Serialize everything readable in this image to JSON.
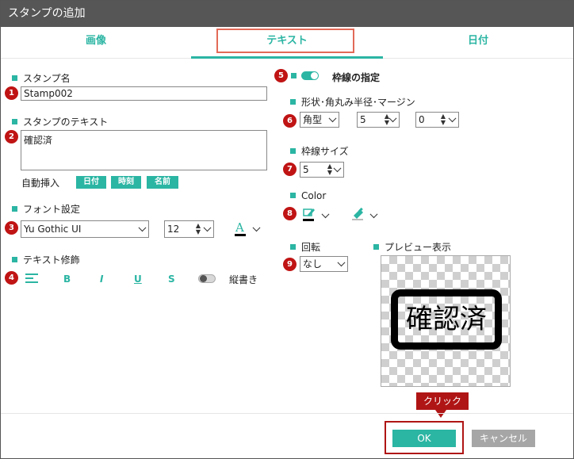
{
  "window": {
    "title": "スタンプの追加"
  },
  "tabs": [
    {
      "label": "画像",
      "active": false
    },
    {
      "label": "テキスト",
      "active": true
    },
    {
      "label": "日付",
      "active": false
    }
  ],
  "left": {
    "stamp_name": {
      "label": "スタンプ名",
      "value": "Stamp002"
    },
    "stamp_text": {
      "label": "スタンプのテキスト",
      "value": "確認済"
    },
    "auto_insert": {
      "label": "自動挿入",
      "chips": [
        "日付",
        "時刻",
        "名前"
      ]
    },
    "font": {
      "label": "フォント設定",
      "family": "Yu Gothic UI",
      "size": "12"
    },
    "text_decoration": {
      "label": "テキスト修飾",
      "bold": "B",
      "italic": "I",
      "underline": "U",
      "strike": "S",
      "vertical_label": "縦書き",
      "vertical_on": false
    }
  },
  "right": {
    "border": {
      "label": "枠線の指定",
      "on": true
    },
    "shape": {
      "label": "形状･角丸み半径･マージン",
      "type": "角型",
      "radius": "5",
      "margin": "0"
    },
    "border_size": {
      "label": "枠線サイズ",
      "value": "5"
    },
    "color": {
      "label": "Color"
    },
    "rotation": {
      "label": "回転",
      "value": "なし"
    },
    "preview": {
      "label": "プレビュー表示",
      "stamp_text": "確認済"
    }
  },
  "badges": [
    "1",
    "2",
    "3",
    "4",
    "5",
    "6",
    "7",
    "8",
    "9"
  ],
  "footer": {
    "ok_label": "OK",
    "cancel_label": "キャンセル",
    "callout": "クリック"
  },
  "colors": {
    "accent": "#2bb5a3",
    "badge": "#c01414",
    "title_bar": "#565656",
    "cancel": "#a6a6a6",
    "highlight": "#e26a57"
  },
  "icons": [
    "align-icon",
    "font-color-icon",
    "border-color-icon",
    "fill-color-icon",
    "chevron-down-icon"
  ]
}
